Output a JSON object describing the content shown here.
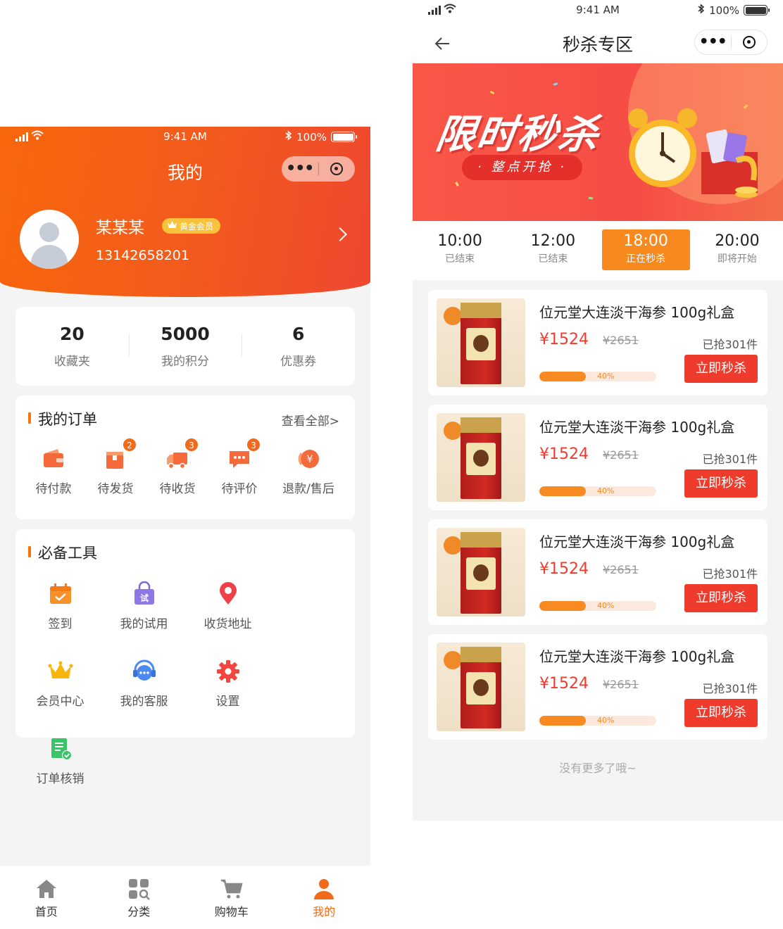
{
  "status": {
    "time": "9:41 AM",
    "battery": "100%"
  },
  "profile_page": {
    "title": "我的",
    "user": {
      "name": "某某某",
      "badge": "黄金会员",
      "phone": "13142658201"
    },
    "stats": [
      {
        "value": "20",
        "label": "收藏夹"
      },
      {
        "value": "5000",
        "label": "我的积分"
      },
      {
        "value": "6",
        "label": "优惠券"
      }
    ],
    "orders": {
      "title": "我的订单",
      "view_all": "查看全部>",
      "items": [
        {
          "label": "待付款",
          "icon": "wallet-icon",
          "badge": ""
        },
        {
          "label": "待发货",
          "icon": "package-icon",
          "badge": "2"
        },
        {
          "label": "待收货",
          "icon": "truck-icon",
          "badge": "3"
        },
        {
          "label": "待评价",
          "icon": "comment-icon",
          "badge": "3"
        },
        {
          "label": "退款/售后",
          "icon": "refund-icon",
          "badge": ""
        }
      ]
    },
    "tools": {
      "title": "必备工具",
      "items": [
        {
          "label": "签到",
          "icon": "calendar-check-icon"
        },
        {
          "label": "我的试用",
          "icon": "trial-bag-icon"
        },
        {
          "label": "收货地址",
          "icon": "location-pin-icon"
        },
        {
          "label": "会员中心",
          "icon": "crown-icon"
        },
        {
          "label": "我的客服",
          "icon": "headset-icon"
        },
        {
          "label": "设置",
          "icon": "gear-icon"
        },
        {
          "label": "订单核销",
          "icon": "verify-document-icon"
        }
      ]
    },
    "tabbar": [
      {
        "label": "首页",
        "icon": "home-icon",
        "active": false
      },
      {
        "label": "分类",
        "icon": "category-icon",
        "active": false
      },
      {
        "label": "购物车",
        "icon": "cart-icon",
        "active": false
      },
      {
        "label": "我的",
        "icon": "user-icon",
        "active": true
      }
    ]
  },
  "flash_page": {
    "title": "秒杀专区",
    "banner": {
      "headline": "限时秒杀",
      "subline": "· 整点开抢 ·"
    },
    "time_slots": [
      {
        "time": "10:00",
        "status": "已结束",
        "active": false
      },
      {
        "time": "12:00",
        "status": "已结束",
        "active": false
      },
      {
        "time": "18:00",
        "status": "正在秒杀",
        "active": true
      },
      {
        "time": "20:00",
        "status": "即将开始",
        "active": false
      }
    ],
    "products": [
      {
        "name": "位元堂大连淡干海参 100g礼盒",
        "price": "¥1524",
        "original": "¥2651",
        "sold": "已抢301件",
        "progress": 40,
        "progress_label": "40%",
        "button": "立即秒杀"
      },
      {
        "name": "位元堂大连淡干海参 100g礼盒",
        "price": "¥1524",
        "original": "¥2651",
        "sold": "已抢301件",
        "progress": 40,
        "progress_label": "40%",
        "button": "立即秒杀"
      },
      {
        "name": "位元堂大连淡干海参 100g礼盒",
        "price": "¥1524",
        "original": "¥2651",
        "sold": "已抢301件",
        "progress": 40,
        "progress_label": "40%",
        "button": "立即秒杀"
      },
      {
        "name": "位元堂大连淡干海参 100g礼盒",
        "price": "¥1524",
        "original": "¥2651",
        "sold": "已抢301件",
        "progress": 40,
        "progress_label": "40%",
        "button": "立即秒杀"
      }
    ],
    "no_more": "没有更多了哦~"
  },
  "colors": {
    "brand_orange": "#f7670c",
    "flash_red": "#ef3b2c",
    "accent_orange": "#f8891f"
  }
}
